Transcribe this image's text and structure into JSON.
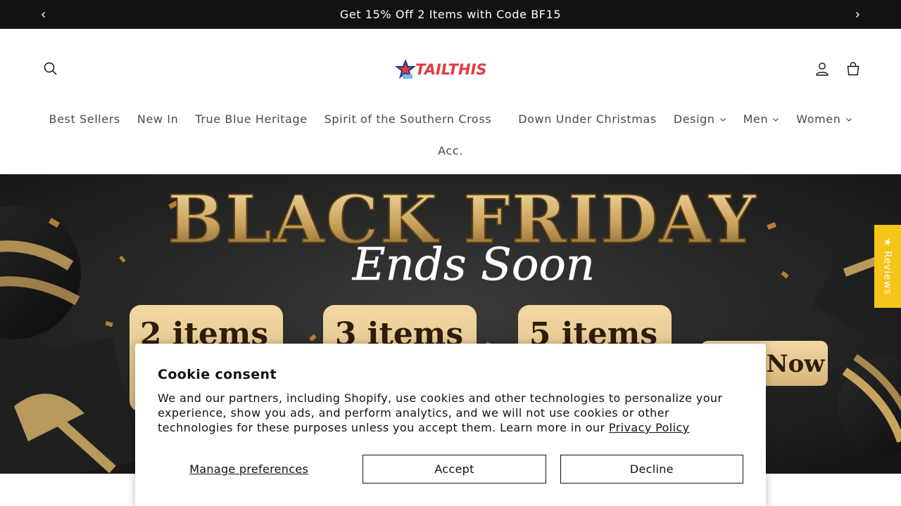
{
  "announcement": {
    "text": "Get 15% Off 2 Items with Code BF15",
    "prev_icon": "chevron-left-icon",
    "next_icon": "chevron-right-icon"
  },
  "header": {
    "logo_text": "TAILTHIS",
    "icons": [
      "search-icon",
      "account-icon",
      "cart-icon"
    ]
  },
  "nav": {
    "row1": [
      {
        "label": "Best Sellers",
        "dropdown": false
      },
      {
        "label": "New In",
        "dropdown": false
      },
      {
        "label": "True Blue Heritage",
        "dropdown": false
      },
      {
        "label": "Spirit of the Southern Cross",
        "dropdown": false
      },
      {
        "label": "Down Under Christmas",
        "dropdown": false
      },
      {
        "label": "Design",
        "dropdown": true
      },
      {
        "label": "Men",
        "dropdown": true
      },
      {
        "label": "Women",
        "dropdown": true
      }
    ],
    "row2": [
      {
        "label": "Acc.",
        "dropdown": false
      }
    ]
  },
  "hero": {
    "headline": "BLACK FRIDAY",
    "script_text": "Ends Soon",
    "tiles": [
      "2 items",
      "3 items",
      "5 items"
    ],
    "cta_partial": "Now"
  },
  "reviews_tab": {
    "label": "★ Reviews",
    "color": "#f5c518"
  },
  "cookie": {
    "title": "Cookie consent",
    "body": "We and our partners, including Shopify, use cookies and other technologies to personalize your experience, show you ads, and perform analytics, and we will not use cookies or other technologies for these purposes unless you accept them. Learn more in our ",
    "privacy_link": "Privacy Policy",
    "manage_label": "Manage preferences",
    "accept_label": "Accept",
    "decline_label": "Decline"
  },
  "colors": {
    "announcement_bg": "#121212",
    "logo_red": "#e23a44",
    "logo_blue": "#1d3a8f",
    "gold": "#d9b97a"
  }
}
